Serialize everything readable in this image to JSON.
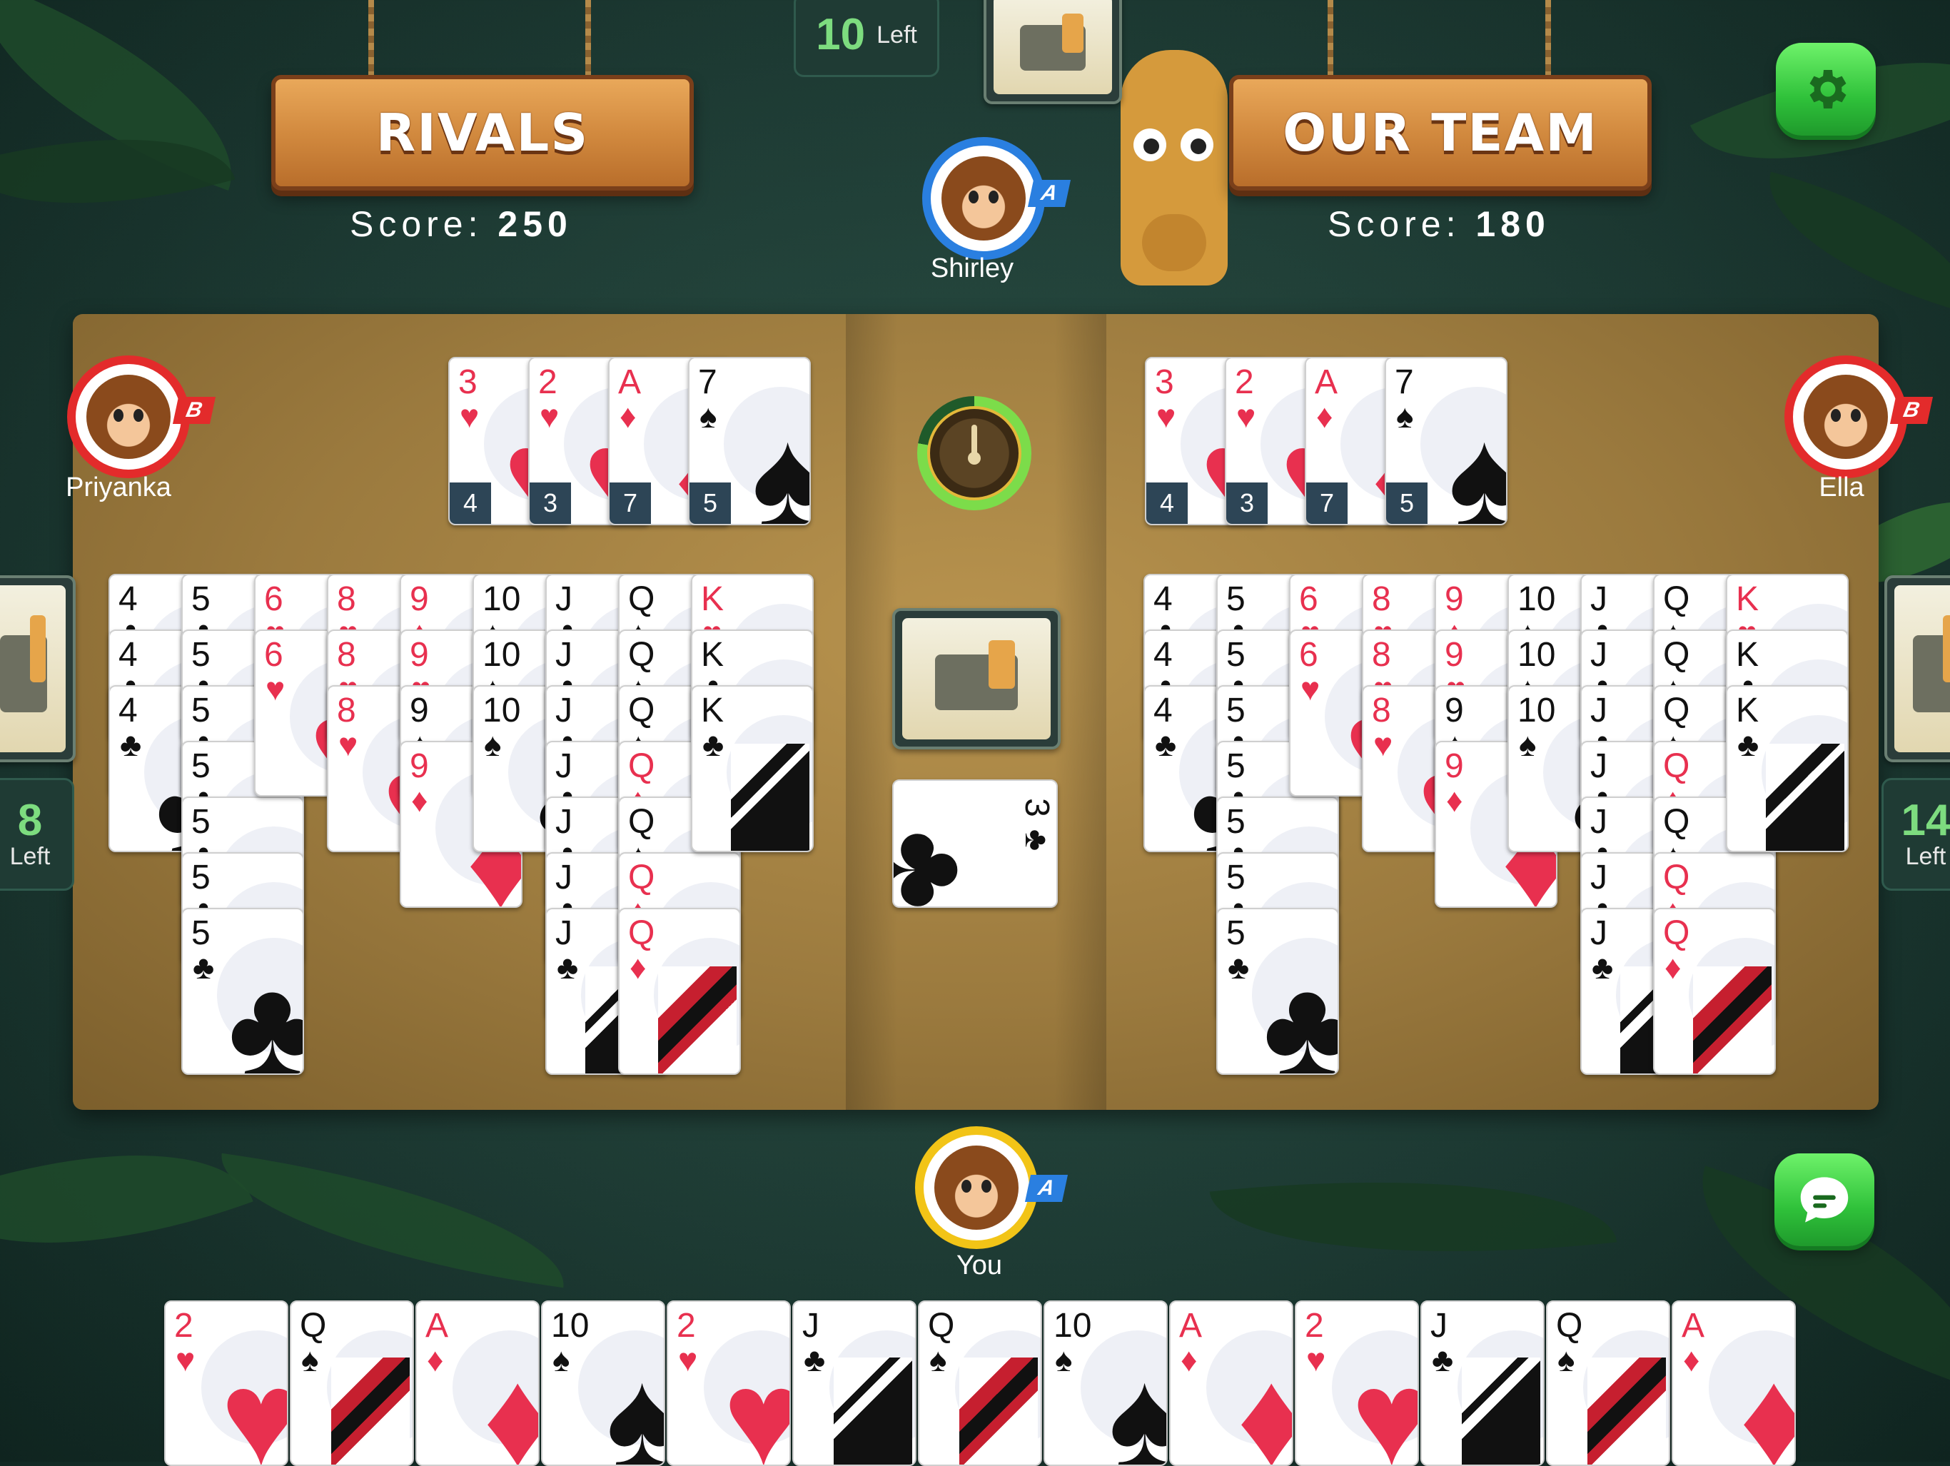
{
  "top": {
    "draw_pile": {
      "count": "10",
      "label": "Left"
    }
  },
  "teams": {
    "rivals": {
      "title": "RIVALS",
      "score_label": "Score:",
      "score": "250"
    },
    "ours": {
      "title": "OUR TEAM",
      "score_label": "Score:",
      "score": "180"
    }
  },
  "players": {
    "top": {
      "name": "Shirley",
      "tag": "A"
    },
    "left": {
      "name": "Priyanka",
      "tag": "B",
      "cards_left": "8",
      "left_label": "Left"
    },
    "right": {
      "name": "Ella",
      "tag": "B",
      "cards_left": "14",
      "left_label": "Left"
    },
    "bottom": {
      "name": "You",
      "tag": "A"
    }
  },
  "icons": {
    "settings": "gear-icon",
    "chat": "chat-bubble-icon",
    "timer": "timer-dial-icon"
  },
  "colors": {
    "red": "#e8304f",
    "black": "#111111",
    "green_button": "#2fc13a"
  },
  "rivals_meld_summary": [
    {
      "rank": "3",
      "suit": "♥",
      "count": "4"
    },
    {
      "rank": "2",
      "suit": "♥",
      "count": "3"
    },
    {
      "rank": "A",
      "suit": "♦",
      "count": "7"
    },
    {
      "rank": "7",
      "suit": "♠",
      "count": "5"
    }
  ],
  "ours_meld_summary": [
    {
      "rank": "3",
      "suit": "♥",
      "count": "4"
    },
    {
      "rank": "2",
      "suit": "♥",
      "count": "3"
    },
    {
      "rank": "A",
      "suit": "♦",
      "count": "7"
    },
    {
      "rank": "7",
      "suit": "♠",
      "count": "5"
    }
  ],
  "rivals_melds": [
    {
      "ranks": [
        "4",
        "4",
        "4"
      ],
      "suits": [
        "♣",
        "♣",
        "♣"
      ]
    },
    {
      "ranks": [
        "5",
        "5",
        "5",
        "5",
        "5",
        "5",
        "5"
      ],
      "suits": [
        "♣",
        "♣",
        "♣",
        "♣",
        "♣",
        "♣",
        "♣"
      ]
    },
    {
      "ranks": [
        "6",
        "6"
      ],
      "suits": [
        "♥",
        "♥"
      ]
    },
    {
      "ranks": [
        "8",
        "8",
        "8"
      ],
      "suits": [
        "♥",
        "♥",
        "♥"
      ]
    },
    {
      "ranks": [
        "9",
        "9",
        "9",
        "9"
      ],
      "suits": [
        "♦",
        "♥",
        "♠",
        "♦"
      ]
    },
    {
      "ranks": [
        "10",
        "10",
        "10"
      ],
      "suits": [
        "♠",
        "♠",
        "♠"
      ]
    },
    {
      "ranks": [
        "J",
        "J",
        "J",
        "J",
        "J",
        "J",
        "J"
      ],
      "suits": [
        "♣",
        "♣",
        "♣",
        "♣",
        "♣",
        "♣",
        "♣"
      ]
    },
    {
      "ranks": [
        "Q",
        "Q",
        "Q",
        "Q",
        "Q",
        "Q",
        "Q"
      ],
      "suits": [
        "♠",
        "♠",
        "♠",
        "♦",
        "♠",
        "♦",
        "♦"
      ]
    },
    {
      "ranks": [
        "K",
        "K",
        "K"
      ],
      "suits": [
        "♥",
        "♣",
        "♣"
      ]
    }
  ],
  "ours_melds": [
    {
      "ranks": [
        "4",
        "4",
        "4"
      ],
      "suits": [
        "♣",
        "♣",
        "♣"
      ]
    },
    {
      "ranks": [
        "5",
        "5",
        "5",
        "5",
        "5",
        "5",
        "5"
      ],
      "suits": [
        "♣",
        "♣",
        "♣",
        "♣",
        "♣",
        "♣",
        "♣"
      ]
    },
    {
      "ranks": [
        "6",
        "6"
      ],
      "suits": [
        "♥",
        "♥"
      ]
    },
    {
      "ranks": [
        "8",
        "8",
        "8"
      ],
      "suits": [
        "♥",
        "♥",
        "♥"
      ]
    },
    {
      "ranks": [
        "9",
        "9",
        "9",
        "9"
      ],
      "suits": [
        "♦",
        "♥",
        "♠",
        "♦"
      ]
    },
    {
      "ranks": [
        "10",
        "10",
        "10"
      ],
      "suits": [
        "♠",
        "♠",
        "♠"
      ]
    },
    {
      "ranks": [
        "J",
        "J",
        "J",
        "J",
        "J",
        "J",
        "J"
      ],
      "suits": [
        "♣",
        "♣",
        "♣",
        "♣",
        "♣",
        "♣",
        "♣"
      ]
    },
    {
      "ranks": [
        "Q",
        "Q",
        "Q",
        "Q",
        "Q",
        "Q",
        "Q"
      ],
      "suits": [
        "♠",
        "♠",
        "♠",
        "♦",
        "♠",
        "♦",
        "♦"
      ]
    },
    {
      "ranks": [
        "K",
        "K",
        "K"
      ],
      "suits": [
        "♥",
        "♣",
        "♣"
      ]
    }
  ],
  "discard": {
    "rank": "3",
    "suit": "♣"
  },
  "hand": [
    {
      "rank": "2",
      "suit": "♥"
    },
    {
      "rank": "Q",
      "suit": "♠"
    },
    {
      "rank": "A",
      "suit": "♦"
    },
    {
      "rank": "10",
      "suit": "♠"
    },
    {
      "rank": "2",
      "suit": "♥"
    },
    {
      "rank": "J",
      "suit": "♣"
    },
    {
      "rank": "Q",
      "suit": "♠"
    },
    {
      "rank": "10",
      "suit": "♠"
    },
    {
      "rank": "A",
      "suit": "♦"
    },
    {
      "rank": "2",
      "suit": "♥"
    },
    {
      "rank": "J",
      "suit": "♣"
    },
    {
      "rank": "Q",
      "suit": "♠"
    },
    {
      "rank": "A",
      "suit": "♦"
    }
  ]
}
